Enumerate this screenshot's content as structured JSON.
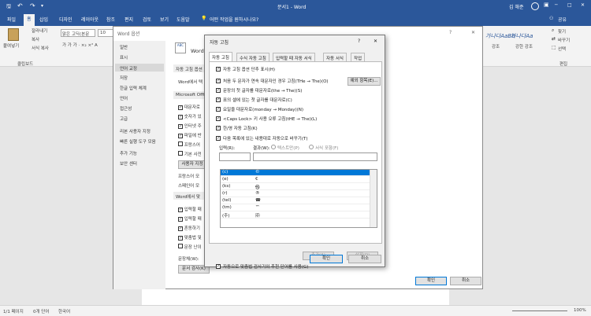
{
  "titlebar": {
    "title": "문서1 - Word",
    "user": "김 해준",
    "qat": [
      "save-icon",
      "undo-icon",
      "redo-icon",
      "customize-icon"
    ],
    "win_buttons": [
      "─",
      "□",
      "✕"
    ]
  },
  "tabs": [
    "파일",
    "홈",
    "삽입",
    "디자인",
    "레이아웃",
    "참조",
    "편지",
    "검토",
    "보기",
    "도움말"
  ],
  "active_tab": "홈",
  "tell_me": "어떤 작업을 원하시나요?",
  "share": "공유",
  "ribbon": {
    "paste_label": "붙여넣기",
    "cut": "잘라내기",
    "copy": "복사",
    "format_painter": "서식 복사",
    "clipboard_group": "클립보드",
    "font_name": "맑은 고딕(본문",
    "font_size": "10",
    "format_buttons": "가 가 가 · ×₂ ×² A",
    "style_samples": [
      "가나다AaBb",
      "가나다Aa"
    ],
    "style_names": [
      "강조",
      "강한 강조"
    ],
    "find": "찾기",
    "replace": "바꾸기",
    "select": "선택",
    "edit_group": "편집"
  },
  "options_dialog": {
    "title": "Word 옵션",
    "help": "?",
    "close": "✕",
    "side_items": [
      "일반",
      "표시",
      "언어 교정",
      "저장",
      "한글 입력 체계",
      "언어",
      "접근성",
      "고급",
      "리본 사용자 지정",
      "빠른 실행 도구 모음",
      "추가 기능",
      "보안 센터"
    ],
    "selected_side": "언어 교정",
    "main_heading": "Word의",
    "main_heading_suffix": "ABC",
    "autocorrect_section": "자동 고침 옵션",
    "autocorrect_desc": "Word에서 텍",
    "office_section": "Microsoft Offi",
    "office_items": [
      "대문자로",
      "숫자가 있",
      "인터넷 주",
      "파일에 반",
      "프랑스어",
      "기본 사전"
    ],
    "custom_dict_button": "사용자 지정",
    "french_label": "프랑스어 모",
    "spanish_label": "스페인어 모",
    "word_section": "Word에서 맞",
    "word_items": [
      "입력할 때",
      "입력할 때",
      "혼동하기",
      "맞춤법 및",
      "문장 난이"
    ],
    "grammar_label": "문장체(W):",
    "doc_check_button": "문서 검사(K)",
    "ok": "확인",
    "cancel": "취소"
  },
  "autocorrect_dialog": {
    "title": "자동 고침",
    "help": "?",
    "close": "✕",
    "tabs": [
      "자동 고침",
      "수식 자동 고침",
      "입력할 때 자동 서식",
      "자동 서식",
      "작업"
    ],
    "active_tab": "자동 고침",
    "options": [
      {
        "label": "자동 고침 옵션 단추 표시(H)",
        "checked": true
      },
      {
        "label": "처음 두 문자가 연속 대문자인 경우 고침(THe → The)(O)",
        "checked": true
      },
      {
        "label": "문장의 첫 글자를 대문자로(the → The)(S)",
        "checked": true
      },
      {
        "label": "표의 셀에 있는 첫 글자를 대문자로(C)",
        "checked": true
      },
      {
        "label": "요일을 대문자로(monday → Monday)(N)",
        "checked": true
      },
      {
        "label": "<Caps Lock> 키 사용 오류 고침(tHE → The)(L)",
        "checked": true
      },
      {
        "label": "한/영 자동 고침(K)",
        "checked": true
      }
    ],
    "exceptions_button": "예외 항목(E)...",
    "replace_as_type": {
      "label": "다음 목록에 있는 내용대로 자동으로 바꾸기(T)",
      "checked": true
    },
    "input_label": "입력(R):",
    "result_label": "결과(W):",
    "text_only": "텍스트만(P)",
    "formatted": "서식 포함(F)",
    "rows": [
      [
        "(c)",
        "©"
      ],
      [
        "(e)",
        "€"
      ],
      [
        "(ks)",
        "㉿"
      ],
      [
        "(r)",
        "®"
      ],
      [
        "(tel)",
        "☎"
      ],
      [
        "(tm)",
        "™"
      ],
      [
        "(주)",
        "㈜"
      ]
    ],
    "add_button": "추가(A)",
    "delete_button": "삭제(D)",
    "spell_suggest": {
      "label": "자동으로 맞춤법 검사기의 추천 단어를 사용(G)",
      "checked": true
    },
    "ok": "확인",
    "cancel": "취소"
  },
  "status": {
    "page": "1/1 페이지",
    "words": "0개 단어",
    "language": "한국어",
    "zoom": "100%"
  }
}
